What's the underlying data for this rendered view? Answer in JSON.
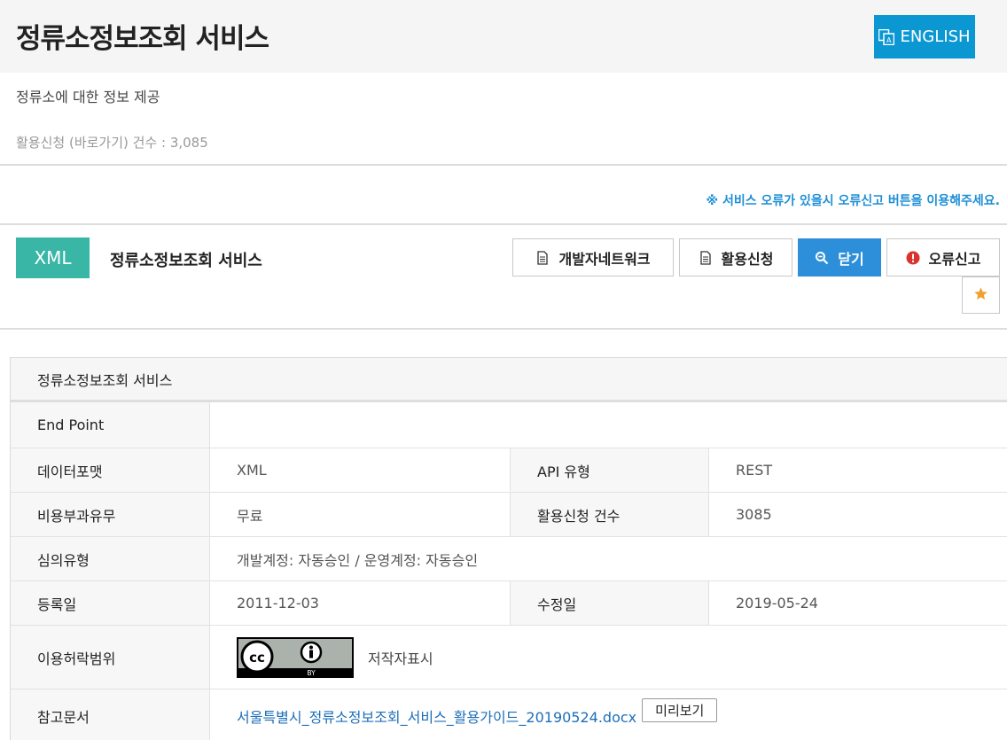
{
  "header": {
    "title": "정류소정보조회 서비스",
    "english_label": "ENGLISH",
    "description": "정류소에 대한 정보 제공",
    "stats": "활용신청 (바로가기) 건수 : 3,085"
  },
  "notice": "※ 서비스 오류가 있을시 오류신고 버튼을 이용해주세요.",
  "service": {
    "badge": "XML",
    "name": "정류소정보조회 서비스",
    "buttons": {
      "dev_network": "개발자네트워크",
      "apply": "활용신청",
      "close": "닫기",
      "report": "오류신고"
    }
  },
  "detail": {
    "title": "정류소정보조회 서비스",
    "endpoint_label": "End Point",
    "endpoint_value": "",
    "format_label": "데이터포맷",
    "format_value": "XML",
    "api_type_label": "API 유형",
    "api_type_value": "REST",
    "fee_label": "비용부과유무",
    "fee_value": "무료",
    "apply_count_label": "활용신청 건수",
    "apply_count_value": "3085",
    "review_label": "심의유형",
    "review_value": "개발계정: 자동승인 / 운영계정: 자동승인",
    "reg_label": "등록일",
    "reg_value": "2011-12-03",
    "mod_label": "수정일",
    "mod_value": "2019-05-24",
    "license_label": "이용허락범위",
    "license_text": "저작자표시",
    "license_badge_text": "BY",
    "ref_label": "참고문서",
    "ref_link": "서울특별시_정류소정보조회_서비스_활용가이드_20190524.docx",
    "preview_label": "미리보기"
  },
  "colors": {
    "english_btn": "#0b97d2",
    "xml_badge": "#39b6a5",
    "close_btn": "#2d8fd9",
    "notice": "#1d8fd6",
    "star": "#f0a030",
    "error_icon": "#d9322f"
  }
}
